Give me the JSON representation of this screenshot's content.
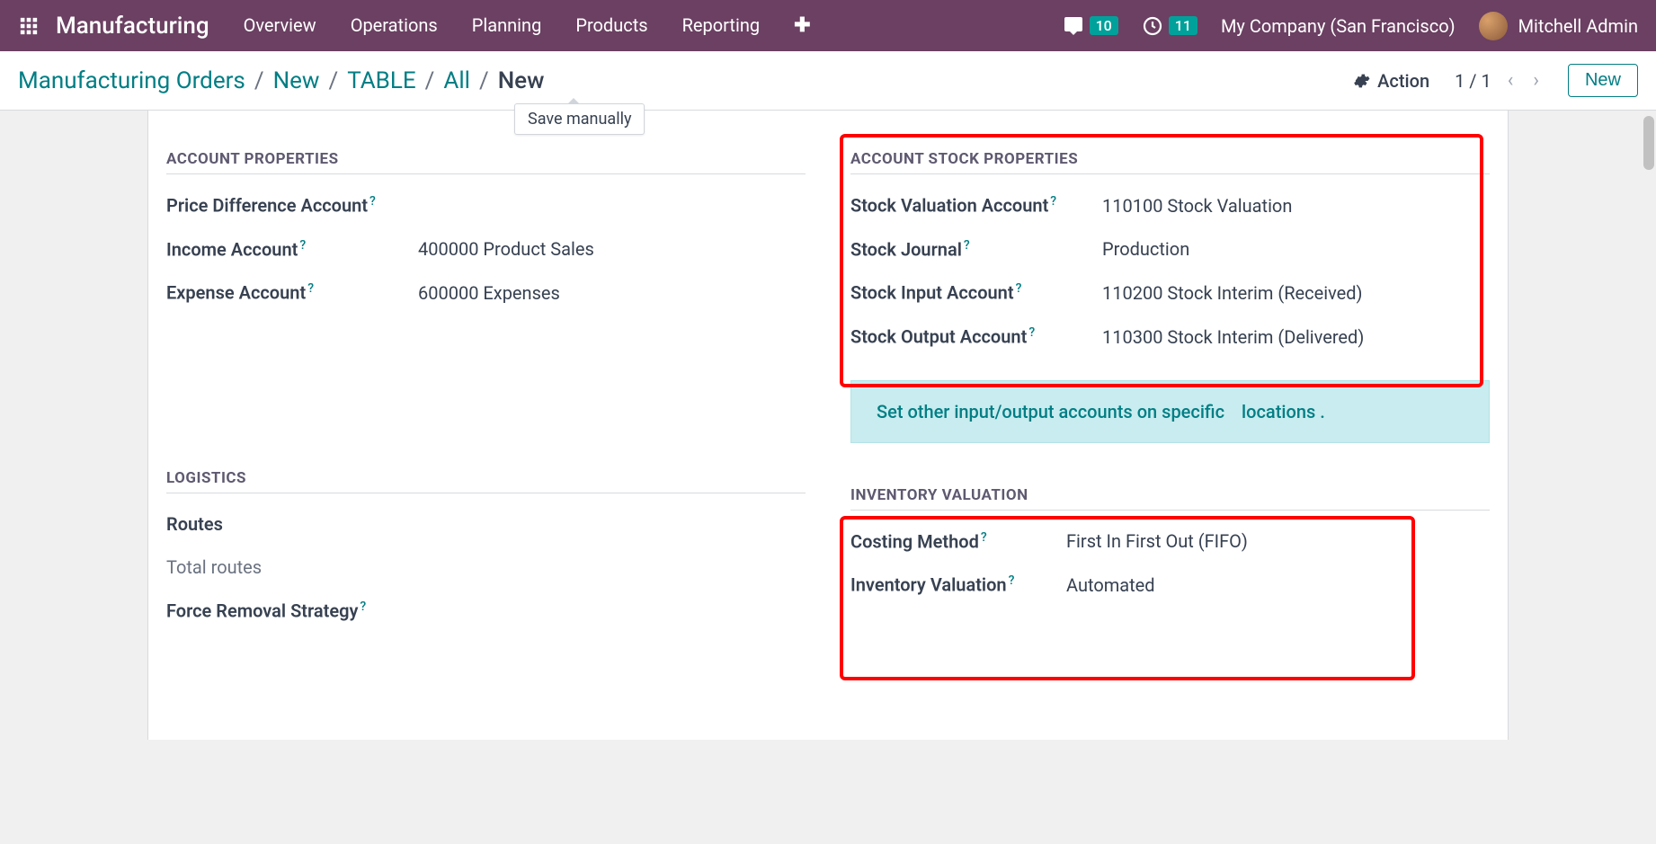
{
  "nav": {
    "brand": "Manufacturing",
    "menu": [
      "Overview",
      "Operations",
      "Planning",
      "Products",
      "Reporting"
    ],
    "chat_badge": "10",
    "activity_badge": "11",
    "company": "My Company (San Francisco)",
    "user": "Mitchell Admin"
  },
  "breadcrumb": {
    "items": [
      "Manufacturing Orders",
      "New",
      "TABLE",
      "All"
    ],
    "active": "New"
  },
  "tooltip": "Save manually",
  "controlbar": {
    "action_label": "Action",
    "pager": "1 / 1",
    "new_label": "New"
  },
  "sections": {
    "account_properties": {
      "title": "ACCOUNT PROPERTIES",
      "fields": {
        "price_diff": {
          "label": "Price Difference Account",
          "value": ""
        },
        "income": {
          "label": "Income Account",
          "value": "400000 Product Sales"
        },
        "expense": {
          "label": "Expense Account",
          "value": "600000 Expenses"
        }
      }
    },
    "account_stock": {
      "title": "ACCOUNT STOCK PROPERTIES",
      "fields": {
        "valuation": {
          "label": "Stock Valuation Account",
          "value": "110100 Stock Valuation"
        },
        "journal": {
          "label": "Stock Journal",
          "value": "Production"
        },
        "input": {
          "label": "Stock Input Account",
          "value": "110200 Stock Interim (Received)"
        },
        "output": {
          "label": "Stock Output Account",
          "value": "110300 Stock Interim (Delivered)"
        }
      }
    },
    "hint": {
      "text": "Set other input/output accounts on specific",
      "link": "locations",
      "trail": "."
    },
    "logistics": {
      "title": "LOGISTICS",
      "fields": {
        "routes": {
          "label": "Routes",
          "value": ""
        },
        "total_routes": {
          "label": "Total routes",
          "value": ""
        },
        "force_removal": {
          "label": "Force Removal Strategy",
          "value": ""
        }
      }
    },
    "inventory_valuation": {
      "title": "INVENTORY VALUATION",
      "fields": {
        "costing": {
          "label": "Costing Method",
          "value": "First In First Out (FIFO)"
        },
        "valuation": {
          "label": "Inventory Valuation",
          "value": "Automated"
        }
      }
    }
  }
}
